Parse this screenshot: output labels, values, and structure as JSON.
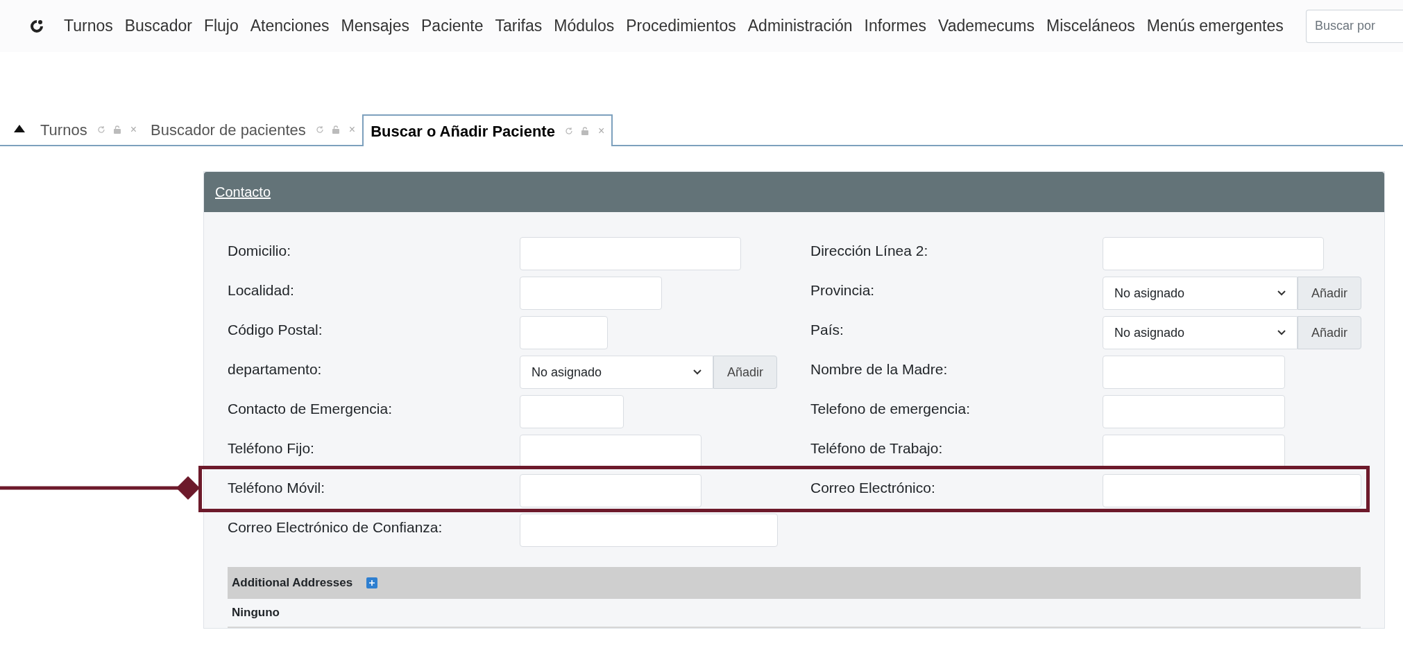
{
  "menu": {
    "items": [
      "Turnos",
      "Buscador",
      "Flujo",
      "Atenciones",
      "Mensajes",
      "Paciente",
      "Tarifas",
      "Módulos",
      "Procedimientos",
      "Administración",
      "Informes",
      "Vademecums",
      "Misceláneos",
      "Menús emergentes"
    ]
  },
  "search": {
    "placeholder": "Buscar por"
  },
  "tabs": [
    {
      "label": "Turnos",
      "selected": false,
      "close": "×"
    },
    {
      "label": "Buscador de pacientes",
      "selected": false,
      "close": "×"
    },
    {
      "label": "Buscar o Añadir Paciente",
      "selected": true,
      "close": "×"
    }
  ],
  "panel": {
    "title": "Contacto",
    "rows": [
      {
        "highlighted": false,
        "fields": [
          {
            "label": "Domicilio:",
            "kind": "text"
          },
          {
            "label": "Dirección Línea 2:",
            "kind": "text"
          }
        ]
      },
      {
        "highlighted": false,
        "fields": [
          {
            "label": "Localidad:",
            "kind": "text"
          },
          {
            "label": "Provincia:",
            "kind": "select",
            "value": "No asignado",
            "button": "Añadir"
          }
        ]
      },
      {
        "highlighted": false,
        "fields": [
          {
            "label": "Código Postal:",
            "kind": "text"
          },
          {
            "label": "País:",
            "kind": "select",
            "value": "No asignado",
            "button": "Añadir"
          }
        ]
      },
      {
        "highlighted": false,
        "fields": [
          {
            "label": "departamento:",
            "kind": "select",
            "value": "No asignado",
            "button": "Añadir"
          },
          {
            "label": "Nombre de la Madre:",
            "kind": "text"
          }
        ]
      },
      {
        "highlighted": false,
        "fields": [
          {
            "label": "Contacto de Emergencia:",
            "kind": "text"
          },
          {
            "label": "Telefono de emergencia:",
            "kind": "text"
          }
        ]
      },
      {
        "highlighted": false,
        "fields": [
          {
            "label": "Teléfono Fijo:",
            "kind": "text"
          },
          {
            "label": "Teléfono de Trabajo:",
            "kind": "text"
          }
        ]
      },
      {
        "highlighted": true,
        "fields": [
          {
            "label": "Teléfono Móvil:",
            "kind": "text"
          },
          {
            "label": "Correo Electrónico:",
            "kind": "text"
          }
        ]
      },
      {
        "highlighted": false,
        "fields": [
          {
            "label": "Correo Electrónico de Confianza:",
            "kind": "text"
          }
        ]
      }
    ],
    "additional": {
      "title": "Additional Addresses",
      "empty_text": "Ninguno"
    }
  }
}
